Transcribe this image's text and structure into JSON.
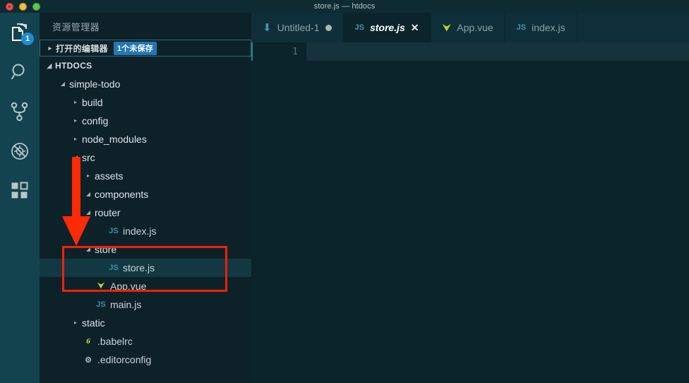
{
  "window": {
    "title": "store.js — htdocs",
    "traffic_lights": [
      "close",
      "minimize",
      "maximize"
    ]
  },
  "activitybar": {
    "items": [
      {
        "name": "explorer",
        "icon": "files-icon",
        "badge": "1",
        "active": true
      },
      {
        "name": "search",
        "icon": "search-icon",
        "badge": "",
        "active": false
      },
      {
        "name": "source-control",
        "icon": "source-control-icon",
        "badge": "",
        "active": false
      },
      {
        "name": "debug",
        "icon": "debug-icon",
        "badge": "",
        "active": false
      },
      {
        "name": "extensions",
        "icon": "extensions-icon",
        "badge": "",
        "active": false
      }
    ]
  },
  "sidebar": {
    "title": "资源管理器",
    "open_editors": {
      "label": "打开的编辑器",
      "badge": "1个未保存",
      "caret": "▸"
    },
    "workspace": {
      "label": "HTDOCS",
      "caret": "◢"
    },
    "tree": [
      {
        "label": "simple-todo",
        "type": "folder",
        "expanded": true,
        "indent": 1,
        "icon": ""
      },
      {
        "label": "build",
        "type": "folder",
        "expanded": false,
        "indent": 2,
        "icon": ""
      },
      {
        "label": "config",
        "type": "folder",
        "expanded": false,
        "indent": 2,
        "icon": ""
      },
      {
        "label": "node_modules",
        "type": "folder",
        "expanded": false,
        "indent": 2,
        "icon": ""
      },
      {
        "label": "src",
        "type": "folder",
        "expanded": true,
        "indent": 2,
        "icon": ""
      },
      {
        "label": "assets",
        "type": "folder",
        "expanded": false,
        "indent": 3,
        "icon": ""
      },
      {
        "label": "components",
        "type": "folder",
        "expanded": true,
        "indent": 3,
        "icon": ""
      },
      {
        "label": "router",
        "type": "folder",
        "expanded": true,
        "indent": 3,
        "icon": ""
      },
      {
        "label": "index.js",
        "type": "file",
        "expanded": null,
        "indent": 4,
        "icon": "js-icon"
      },
      {
        "label": "store",
        "type": "folder",
        "expanded": true,
        "indent": 3,
        "icon": ""
      },
      {
        "label": "store.js",
        "type": "file",
        "expanded": null,
        "indent": 4,
        "icon": "js-icon",
        "selected": true
      },
      {
        "label": "App.vue",
        "type": "file",
        "expanded": null,
        "indent": 3,
        "icon": "vue-icon"
      },
      {
        "label": "main.js",
        "type": "file",
        "expanded": null,
        "indent": 3,
        "icon": "js-icon"
      },
      {
        "label": "static",
        "type": "folder",
        "expanded": false,
        "indent": 2,
        "icon": ""
      },
      {
        "label": ".babelrc",
        "type": "file",
        "expanded": null,
        "indent": 2,
        "icon": "babel-icon"
      },
      {
        "label": ".editorconfig",
        "type": "file",
        "expanded": null,
        "indent": 2,
        "icon": "gear-icon"
      }
    ]
  },
  "editor": {
    "tabs": [
      {
        "label": "Untitled-1",
        "icon": "download-icon",
        "active": false,
        "dirty": true,
        "closeable": false
      },
      {
        "label": "store.js",
        "icon": "js-icon",
        "active": true,
        "dirty": false,
        "closeable": true
      },
      {
        "label": "App.vue",
        "icon": "vue-icon",
        "active": false,
        "dirty": false,
        "closeable": false
      },
      {
        "label": "index.js",
        "icon": "js-icon",
        "active": false,
        "dirty": false,
        "closeable": false
      }
    ],
    "close_glyph": "✕",
    "line_numbers": [
      "1"
    ],
    "content_lines": [
      ""
    ]
  },
  "annotations": {
    "box_color": "#f51f06",
    "arrow_color": "#fc2a05",
    "box_target": "store folder and store.js file",
    "arrow_target": "store folder"
  }
}
